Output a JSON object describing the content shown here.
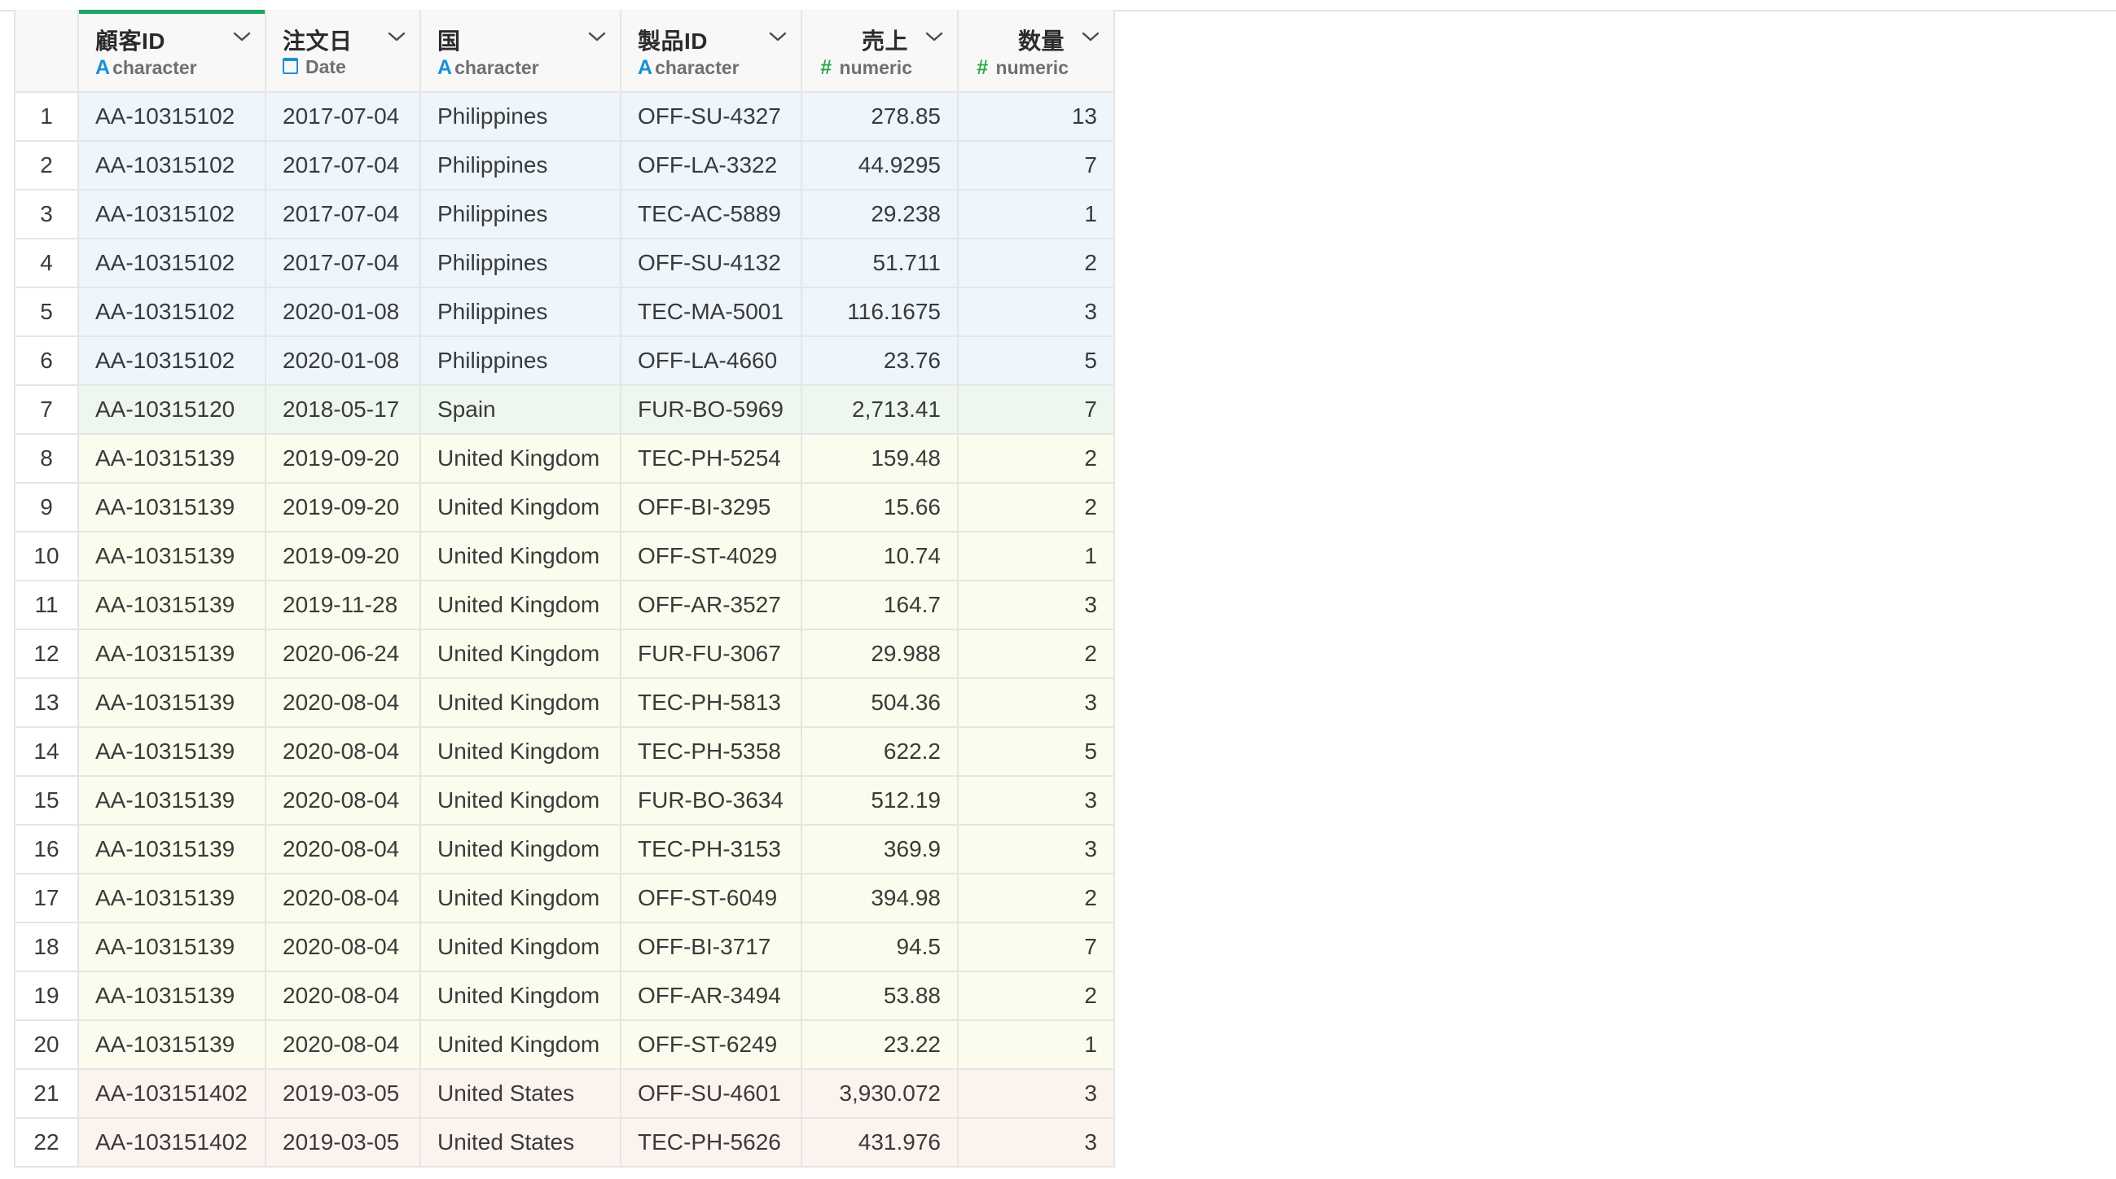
{
  "columns": [
    {
      "name": "顧客ID",
      "type": "character",
      "icon": "character-type-icon",
      "align": "left"
    },
    {
      "name": "注文日",
      "type": "Date",
      "icon": "calendar-icon",
      "align": "left"
    },
    {
      "name": "国",
      "type": "character",
      "icon": "character-type-icon",
      "align": "left"
    },
    {
      "name": "製品ID",
      "type": "character",
      "icon": "character-type-icon",
      "align": "left"
    },
    {
      "name": "売上",
      "type": "numeric",
      "icon": "numeric-type-icon",
      "align": "right"
    },
    {
      "name": "数量",
      "type": "numeric",
      "icon": "numeric-type-icon",
      "align": "right"
    }
  ],
  "colors": {
    "selected_column_accent": "#1aa864",
    "group_philippines": "#edf5fd",
    "group_spain": "#eef7ef",
    "group_united_kingdom": "#fcfcee",
    "group_united_states": "#fdf3ee",
    "character_icon": "#1c8fd6",
    "numeric_icon": "#2ea84b"
  },
  "rows": [
    {
      "index": "1",
      "customer_id": "AA-10315102",
      "order_date": "2017-07-04",
      "country": "Philippines",
      "product_id": "OFF-SU-4327",
      "sales": "278.85",
      "quantity": "13",
      "group": "ph"
    },
    {
      "index": "2",
      "customer_id": "AA-10315102",
      "order_date": "2017-07-04",
      "country": "Philippines",
      "product_id": "OFF-LA-3322",
      "sales": "44.9295",
      "quantity": "7",
      "group": "ph"
    },
    {
      "index": "3",
      "customer_id": "AA-10315102",
      "order_date": "2017-07-04",
      "country": "Philippines",
      "product_id": "TEC-AC-5889",
      "sales": "29.238",
      "quantity": "1",
      "group": "ph"
    },
    {
      "index": "4",
      "customer_id": "AA-10315102",
      "order_date": "2017-07-04",
      "country": "Philippines",
      "product_id": "OFF-SU-4132",
      "sales": "51.711",
      "quantity": "2",
      "group": "ph"
    },
    {
      "index": "5",
      "customer_id": "AA-10315102",
      "order_date": "2020-01-08",
      "country": "Philippines",
      "product_id": "TEC-MA-5001",
      "sales": "116.1675",
      "quantity": "3",
      "group": "ph"
    },
    {
      "index": "6",
      "customer_id": "AA-10315102",
      "order_date": "2020-01-08",
      "country": "Philippines",
      "product_id": "OFF-LA-4660",
      "sales": "23.76",
      "quantity": "5",
      "group": "ph"
    },
    {
      "index": "7",
      "customer_id": "AA-10315120",
      "order_date": "2018-05-17",
      "country": "Spain",
      "product_id": "FUR-BO-5969",
      "sales": "2,713.41",
      "quantity": "7",
      "group": "es"
    },
    {
      "index": "8",
      "customer_id": "AA-10315139",
      "order_date": "2019-09-20",
      "country": "United Kingdom",
      "product_id": "TEC-PH-5254",
      "sales": "159.48",
      "quantity": "2",
      "group": "uk"
    },
    {
      "index": "9",
      "customer_id": "AA-10315139",
      "order_date": "2019-09-20",
      "country": "United Kingdom",
      "product_id": "OFF-BI-3295",
      "sales": "15.66",
      "quantity": "2",
      "group": "uk"
    },
    {
      "index": "10",
      "customer_id": "AA-10315139",
      "order_date": "2019-09-20",
      "country": "United Kingdom",
      "product_id": "OFF-ST-4029",
      "sales": "10.74",
      "quantity": "1",
      "group": "uk"
    },
    {
      "index": "11",
      "customer_id": "AA-10315139",
      "order_date": "2019-11-28",
      "country": "United Kingdom",
      "product_id": "OFF-AR-3527",
      "sales": "164.7",
      "quantity": "3",
      "group": "uk"
    },
    {
      "index": "12",
      "customer_id": "AA-10315139",
      "order_date": "2020-06-24",
      "country": "United Kingdom",
      "product_id": "FUR-FU-3067",
      "sales": "29.988",
      "quantity": "2",
      "group": "uk"
    },
    {
      "index": "13",
      "customer_id": "AA-10315139",
      "order_date": "2020-08-04",
      "country": "United Kingdom",
      "product_id": "TEC-PH-5813",
      "sales": "504.36",
      "quantity": "3",
      "group": "uk"
    },
    {
      "index": "14",
      "customer_id": "AA-10315139",
      "order_date": "2020-08-04",
      "country": "United Kingdom",
      "product_id": "TEC-PH-5358",
      "sales": "622.2",
      "quantity": "5",
      "group": "uk"
    },
    {
      "index": "15",
      "customer_id": "AA-10315139",
      "order_date": "2020-08-04",
      "country": "United Kingdom",
      "product_id": "FUR-BO-3634",
      "sales": "512.19",
      "quantity": "3",
      "group": "uk"
    },
    {
      "index": "16",
      "customer_id": "AA-10315139",
      "order_date": "2020-08-04",
      "country": "United Kingdom",
      "product_id": "TEC-PH-3153",
      "sales": "369.9",
      "quantity": "3",
      "group": "uk"
    },
    {
      "index": "17",
      "customer_id": "AA-10315139",
      "order_date": "2020-08-04",
      "country": "United Kingdom",
      "product_id": "OFF-ST-6049",
      "sales": "394.98",
      "quantity": "2",
      "group": "uk"
    },
    {
      "index": "18",
      "customer_id": "AA-10315139",
      "order_date": "2020-08-04",
      "country": "United Kingdom",
      "product_id": "OFF-BI-3717",
      "sales": "94.5",
      "quantity": "7",
      "group": "uk"
    },
    {
      "index": "19",
      "customer_id": "AA-10315139",
      "order_date": "2020-08-04",
      "country": "United Kingdom",
      "product_id": "OFF-AR-3494",
      "sales": "53.88",
      "quantity": "2",
      "group": "uk"
    },
    {
      "index": "20",
      "customer_id": "AA-10315139",
      "order_date": "2020-08-04",
      "country": "United Kingdom",
      "product_id": "OFF-ST-6249",
      "sales": "23.22",
      "quantity": "1",
      "group": "uk"
    },
    {
      "index": "21",
      "customer_id": "AA-103151402",
      "order_date": "2019-03-05",
      "country": "United States",
      "product_id": "OFF-SU-4601",
      "sales": "3,930.072",
      "quantity": "3",
      "group": "us"
    },
    {
      "index": "22",
      "customer_id": "AA-103151402",
      "order_date": "2019-03-05",
      "country": "United States",
      "product_id": "TEC-PH-5626",
      "sales": "431.976",
      "quantity": "3",
      "group": "us"
    }
  ]
}
